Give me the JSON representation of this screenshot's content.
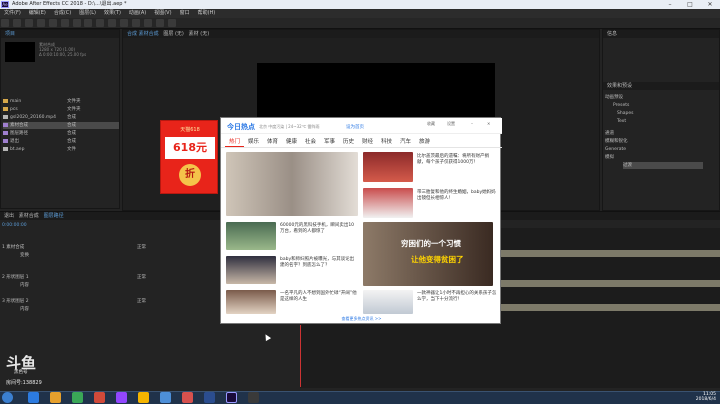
{
  "window": {
    "title": "Adobe After Effects CC 2018 - D:\\...\\退出.aep *",
    "min": "–",
    "max": "□",
    "close": "✕"
  },
  "menubar": [
    "文件(F)",
    "编辑(E)",
    "合成(C)",
    "图层(L)",
    "效果(T)",
    "动画(A)",
    "视图(V)",
    "窗口",
    "帮助(H)"
  ],
  "project": {
    "tab": "项目",
    "thumb_info": [
      "素材合成",
      "1280 x 720 (1.00)",
      "Δ 0:00:10:00, 25.00 fps"
    ],
    "items": [
      {
        "name": "main",
        "type": "文件夹",
        "color": "#d6a84a"
      },
      {
        "name": "pcs",
        "type": "文件夹",
        "color": "#d6a84a"
      },
      {
        "name": "gsl2020_20160.mp4",
        "type": "合成",
        "color": "#b6b6b6"
      },
      {
        "name": "素材合成",
        "type": "合成",
        "color": "#9f7fcf",
        "selected": true
      },
      {
        "name": "图层路径",
        "type": "合成",
        "color": "#9f7fcf"
      },
      {
        "name": "退出",
        "type": "合成",
        "color": "#9f7fcf"
      },
      {
        "name": "bt.aep",
        "type": "文件",
        "color": "#b6b6b6"
      }
    ]
  },
  "viewer": {
    "tab1": "合成 素材合成",
    "tab2": "图层 (无)",
    "tab3": "素材 (无)"
  },
  "right_panel": {
    "tab": "信息",
    "tab2": "效果和预设",
    "items": [
      "动画预设",
      "Presets",
      "Shapes",
      "Text",
      "通道",
      "模糊和锐化",
      "Generate",
      "模拟",
      "过渡"
    ]
  },
  "timeline": {
    "tabs": [
      "退出",
      "素材合成",
      "图层路径"
    ],
    "timecode": "0:00:00:00",
    "rows": [
      {
        "label": "1  素材合成",
        "mode": "正常"
      },
      {
        "label": "  变换",
        "mode": ""
      },
      {
        "label": "2  形状图层 1",
        "mode": "正常"
      },
      {
        "label": "  内容",
        "mode": ""
      },
      {
        "label": "3  形状图层 2",
        "mode": "正常"
      },
      {
        "label": "  内容",
        "mode": ""
      }
    ]
  },
  "red_ad": {
    "top": "天猫618",
    "amount": "618元",
    "circle": "折"
  },
  "news": {
    "logo": "今日热点",
    "sub": "北京 中度污染 | 24~32℃ 雷阵雨",
    "sub2": "设为首页",
    "hbtns": [
      "收藏",
      "设置",
      "–",
      "✕"
    ],
    "tabs": [
      "热门",
      "娱乐",
      "体育",
      "健康",
      "社会",
      "军事",
      "历史",
      "财经",
      "科技",
      "汽车",
      "旅游"
    ],
    "headlines": [
      "比尔盖茨最后的遗嘱：将所有财产捐献，每个孩子仅获得1000万！",
      "带三胎复和他的终生婚姻，baby她妈妈出镜但长相惊人！",
      "60000元的黑科技手机，瞬间卖出10万台，看到的人都惊了",
      "baby和师妇照片被曝光，与其谈论出建的名字？到底怎么了？",
      "一名平凡的人不想到国外忙碌“开阔”他是这样的人生",
      "一款神器让1小时不再担心的关系孩子怎么学，当下十分流行！"
    ],
    "overlay": [
      "穷困们的一个习惯",
      "让他变得贫困了"
    ],
    "footer": "查看更多热点资讯 >>"
  },
  "douyu": {
    "logo": "斗鱼",
    "sub": "黑色号",
    "id": "房间号:138829"
  },
  "clock": {
    "time": "11:05",
    "date": "2018/6/4"
  }
}
